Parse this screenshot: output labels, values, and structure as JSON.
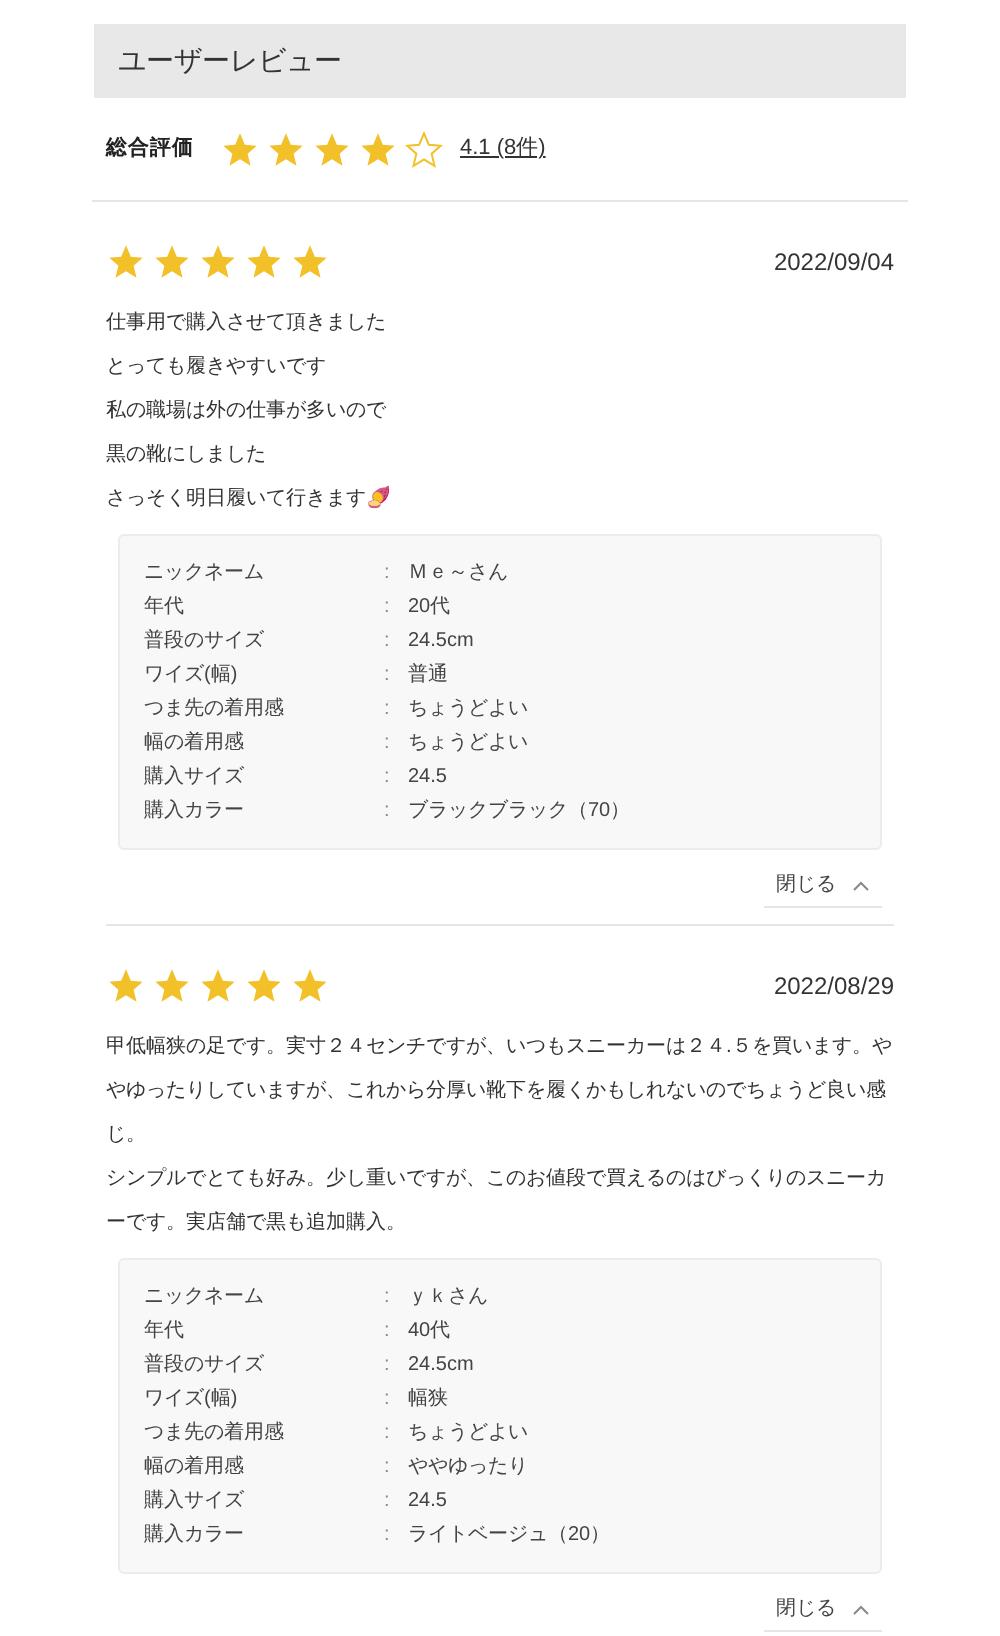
{
  "title": "ユーザーレビュー",
  "summary": {
    "label": "総合評価",
    "stars": 4,
    "score_link": "4.1 (8件)"
  },
  "reviews": [
    {
      "stars": 5,
      "date": "2022/09/04",
      "paragraphs": [
        "仕事用で購入させて頂きました",
        "とっても履きやすいです",
        "私の職場は外の仕事が多いので",
        "黒の靴にしました",
        "さっそく明日履いて行きます🍠"
      ],
      "expanded": true,
      "close_label": "閉じる",
      "details": [
        {
          "label": "ニックネーム",
          "separator": ":",
          "value": "Ｍｅ～さん"
        },
        {
          "label": "年代",
          "separator": ":",
          "value": "20代"
        },
        {
          "label": "普段のサイズ",
          "separator": ":",
          "value": "24.5cm"
        },
        {
          "label": "ワイズ(幅)",
          "separator": ":",
          "value": "普通"
        },
        {
          "label": "つま先の着用感",
          "separator": ":",
          "value": "ちょうどよい"
        },
        {
          "label": "幅の着用感",
          "separator": ":",
          "value": "ちょうどよい"
        },
        {
          "label": "購入サイズ",
          "separator": ":",
          "value": "24.5"
        },
        {
          "label": "購入カラー",
          "separator": ":",
          "value": "ブラックブラック（70）"
        }
      ]
    },
    {
      "stars": 5,
      "date": "2022/08/29",
      "paragraphs": [
        "甲低幅狭の足です。実寸２４センチですが、いつもスニーカーは２４.５を買います。ややゆったりしていますが、これから分厚い靴下を履くかもしれないのでちょうど良い感じ。",
        "シンプルでとても好み。少し重いですが、このお値段で買えるのはびっくりのスニーカーです。実店舗で黒も追加購入。"
      ],
      "expanded": true,
      "close_label": "閉じる",
      "details": [
        {
          "label": "ニックネーム",
          "separator": ":",
          "value": "ｙｋさん"
        },
        {
          "label": "年代",
          "separator": ":",
          "value": "40代"
        },
        {
          "label": "普段のサイズ",
          "separator": ":",
          "value": "24.5cm"
        },
        {
          "label": "ワイズ(幅)",
          "separator": ":",
          "value": "幅狭"
        },
        {
          "label": "つま先の着用感",
          "separator": ":",
          "value": "ちょうどよい"
        },
        {
          "label": "幅の着用感",
          "separator": ":",
          "value": "ややゆったり"
        },
        {
          "label": "購入サイズ",
          "separator": ":",
          "value": "24.5"
        },
        {
          "label": "購入カラー",
          "separator": ":",
          "value": "ライトベージュ（20）"
        }
      ]
    }
  ]
}
